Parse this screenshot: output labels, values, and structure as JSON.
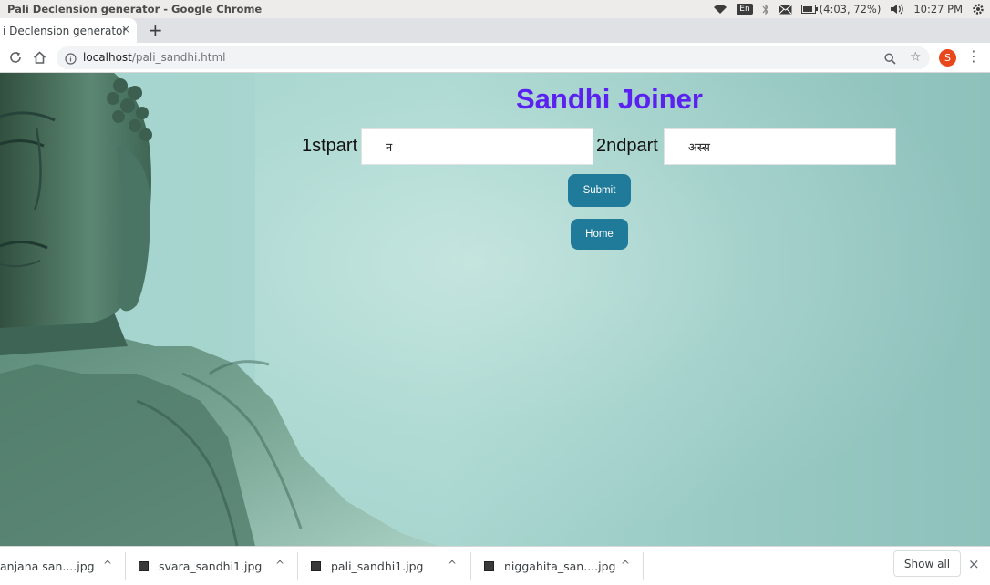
{
  "os": {
    "window_title": "Pali Declension generator - Google Chrome",
    "input_method": "En",
    "battery": "(4:03, 72%)",
    "clock": "10:27 PM"
  },
  "browser": {
    "tab_title": "i Declension generator",
    "tab_close": "×",
    "new_tab": "+",
    "url_host": "localhost",
    "url_path": "/pali_sandhi.html",
    "profile_initial": "S"
  },
  "page": {
    "heading": "Sandhi Joiner",
    "first_label": "1stpart",
    "first_value": "न",
    "second_label": "2ndpart",
    "second_value": "अस्स",
    "submit_label": "Submit",
    "home_label": "Home"
  },
  "downloads": {
    "items": [
      {
        "name": "anjana san....jpg"
      },
      {
        "name": "svara_sandhi1.jpg"
      },
      {
        "name": "pali_sandhi1.jpg"
      },
      {
        "name": "niggahita_san....jpg"
      }
    ],
    "show_all": "Show all",
    "close": "×"
  }
}
